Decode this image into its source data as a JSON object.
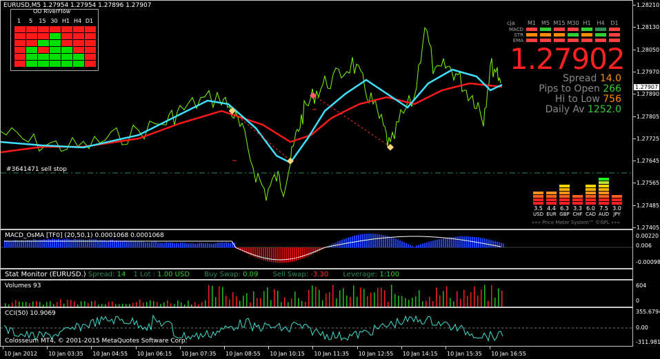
{
  "main": {
    "header": "EURUSD,M5  1.27954 1.27954 1.27896 1.27907",
    "tf_panel_caption": "OO RiverFlow",
    "tf_labels": [
      "1",
      "5",
      "15",
      "30",
      "H1",
      "H4",
      "D1"
    ],
    "tf_grid": [
      [
        "red",
        "red",
        "red",
        "red",
        "red",
        "red",
        "red"
      ],
      [
        "red",
        "red",
        "red",
        "green",
        "red",
        "red",
        "red"
      ],
      [
        "red",
        "red",
        "green",
        "green",
        "red",
        "red",
        "red"
      ],
      [
        "red",
        "green",
        "red",
        "green",
        "green",
        "red",
        "red"
      ],
      [
        "red",
        "green",
        "green",
        "green",
        "green",
        "green",
        "red"
      ],
      [
        "red",
        "green",
        "green",
        "green",
        "green",
        "green",
        "red"
      ]
    ],
    "order_label": "#3641471 sell stop",
    "price_big": "1.27902",
    "stats": [
      {
        "label": "Spread",
        "value": "14.0",
        "color": "#ff8c00"
      },
      {
        "label": "Pips to Open",
        "value": "266",
        "color": "#32cd32"
      },
      {
        "label": "Hi to Low",
        "value": "756",
        "color": "#ff8c00"
      },
      {
        "label": "Daily Av",
        "value": "1252.0",
        "color": "#32cd32"
      }
    ],
    "cja": {
      "title": "cja",
      "cols": [
        "M1",
        "M5",
        "M15",
        "M30",
        "H1",
        "H4",
        "D1"
      ],
      "rows": [
        {
          "label": "MACD",
          "colors": [
            "#ff4040",
            "#32cd32",
            "#ff4040",
            "#ff4040",
            "#32cd32",
            "#2e8b57",
            "#ff4040"
          ]
        },
        {
          "label": "STR",
          "colors": [
            "#ff8c00",
            "#ff8c00",
            "#ff8c00",
            "#32cd32",
            "#ff8c00",
            "#32cd32",
            "#ff4040"
          ]
        },
        {
          "label": "EMA",
          "colors": [
            "#ff4040",
            "#ff4040",
            "#ff4040",
            "#ff4040",
            "#ff4040",
            "#ff4040",
            "#ff4040"
          ]
        }
      ]
    },
    "price_meter": {
      "currencies": [
        {
          "name": "USD",
          "value": "3.5",
          "level": 3.5
        },
        {
          "name": "EUR",
          "value": "4.4",
          "level": 4.4
        },
        {
          "name": "GBP",
          "value": "6.3",
          "level": 6.3
        },
        {
          "name": "CHF",
          "value": "3.3",
          "level": 3.3
        },
        {
          "name": "CAD",
          "value": "6.0",
          "level": 6.0
        },
        {
          "name": "AUD",
          "value": "7.5",
          "level": 7.5
        },
        {
          "name": "JPY",
          "value": "3.0",
          "level": 3.0
        }
      ],
      "footer": "»»» Price Meter System™ ©GPL «««"
    },
    "price_axis": [
      "1.28210",
      "1.28130",
      "1.28050",
      "1.27970",
      "1.27890",
      "1.27805",
      "1.27725",
      "1.27645",
      "1.27565",
      "1.27485",
      "1.27405"
    ],
    "current_price_tag": "1.27907"
  },
  "macd": {
    "label": "MACD_OsMA [TF0] (20,50,1) 0.0001068 0.0001068",
    "axis": [
      "0.00220",
      "0.006",
      "-0.00098"
    ]
  },
  "stat": {
    "prefix": "Stat Monitor (EURUSD.)",
    "spread_label": "Spread:",
    "spread_value": "14",
    "lot_label": "1 Lot :",
    "lot_value": "1.00 USD",
    "buy_swap_label": "Buy Swap:",
    "buy_swap_value": "0.09",
    "sell_swap_label": "Sell Swap:",
    "sell_swap_value": "-3.30",
    "leverage_label": "Leverage:",
    "leverage_value": "1:100"
  },
  "volumes": {
    "label": "Volumes 93",
    "axis": [
      "604",
      "0"
    ]
  },
  "cci": {
    "label": "CCI(50) 10.9069",
    "axis": [
      "355.6794",
      "0.00",
      "-311.9812"
    ]
  },
  "copyright": "Colosseum MT4, © 2001-2015 MetaQuotes Software Corp.",
  "time_axis": [
    "10 Jan 2012",
    "10 Jan 03:35",
    "10 Jan 04:55",
    "10 Jan 06:15",
    "10 Jan 07:35",
    "10 Jan 08:55",
    "10 Jan 10:15",
    "10 Jan 11:35",
    "10 Jan 12:55",
    "10 Jan 14:15",
    "10 Jan 15:35",
    "10 Jan 16:55"
  ]
}
